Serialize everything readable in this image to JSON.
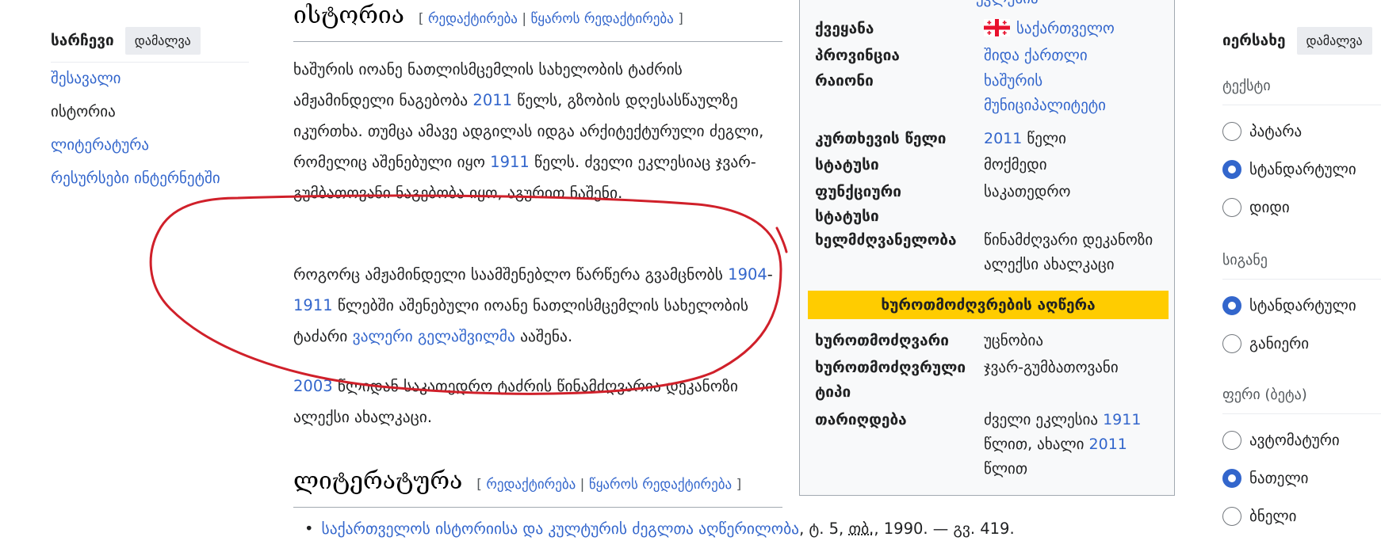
{
  "toc": {
    "title": "სარჩევი",
    "hide_label": "დამალვა",
    "items": [
      {
        "label": "შესავალი"
      },
      {
        "label": "ისტორია"
      },
      {
        "label": "ლიტერატურა"
      },
      {
        "label": "რესურსები ინტერნეტში"
      }
    ]
  },
  "history": {
    "title": "ისტორია",
    "edit_open": "[",
    "edit": "რედაქტირება",
    "pipe": "|",
    "edit_source": "წყაროს რედაქტირება",
    "edit_close": "]",
    "p1": {
      "a": "ხაშურის იოანე ნათლისმცემლის სახელობის ტაძრის ამჟამინდელი ნაგებობა ",
      "year1": "2011",
      "b": " წელს, გზობის დღესასწაულზე იკურთხა. თუმცა ამავე ადგილას იდგა არქიტექტურული ძეგლი, რომელიც აშენებული იყო ",
      "year2": "1911",
      "c": " წელს. ძველი ეკლესიაც ჯვარ-გუმბათოვანი ნაგებობა იყო, აგურით ნაშენი."
    },
    "p2": {
      "a": "როგორც ამჟამინდელი საამშენებლო წარწერა გვამცნობს ",
      "year1": "1904",
      "dash": "-",
      "year2": "1911",
      "b": " წლებში აშენებული იოანე ნათლისმცემლის სახელობის ტაძარი ",
      "link": "ვალერი გელაშვილმა",
      "c": " ააშენა."
    },
    "p3": {
      "year": "2003",
      "a": " წლიდან საკათედრო ტაძრის წინამძღვარია დეკანოზი ალექსი ახალკაცი."
    }
  },
  "literature": {
    "title": "ლიტერატურა",
    "edit_open": "[",
    "edit": "რედაქტირება",
    "pipe": "|",
    "edit_source": "წყაროს რედაქტირება",
    "edit_close": "]",
    "item": {
      "link": "საქართველოს ისტორიისა და კულტურის ძეგლთა აღწერილობა",
      "a": ", ტ. 5, ",
      "abbr": "თბ.",
      "b": ", 1990. — გვ. 419."
    }
  },
  "infobox": {
    "top_value": "ეკლესია",
    "rows": [
      {
        "label": "ქვეყანა",
        "value": "საქართველო"
      },
      {
        "label": "პროვინცია",
        "value": "შიდა ქართლი"
      },
      {
        "label": "რაიონი",
        "value": "ხაშურის მუნიციპალიტეტი"
      },
      {
        "label": "კურთხევის წელი",
        "value_year": "2011",
        "value_rest": " წელი"
      },
      {
        "label": "სტატუსი",
        "value": "მოქმედი"
      },
      {
        "label": "ფუნქციური სტატუსი",
        "value": "საკათედრო"
      },
      {
        "label": "ხელმძღვანელობა",
        "value": "წინამძღვარი დეკანოზი ალექსი ახალკაცი"
      }
    ],
    "header": "ხუროთმოძღვრების აღწერა",
    "rows2": [
      {
        "label": "ხუროთმოძღვარი",
        "value": "უცნობია"
      },
      {
        "label": "ხუროთმოძღვრული ტიპი",
        "value": "ჯვარ-გუმბათოვანი"
      },
      {
        "label": "თარიღდება",
        "v1": "ძველი ეკლესია ",
        "y1": "1911",
        "v2": " წლით, ახალი ",
        "y2": "2011",
        "v3": " წლით"
      }
    ]
  },
  "appearance": {
    "title": "იერსახე",
    "hide_label": "დამალვა",
    "text_label": "ტექსტი",
    "text_options": [
      {
        "label": "პატარა",
        "checked": false
      },
      {
        "label": "სტანდარტული",
        "checked": true
      },
      {
        "label": "დიდი",
        "checked": false
      }
    ],
    "width_label": "სიგანე",
    "width_options": [
      {
        "label": "სტანდარტული",
        "checked": true
      },
      {
        "label": "განიერი",
        "checked": false
      }
    ],
    "color_label": "ფერი (ბეტა)",
    "color_options": [
      {
        "label": "ავტომატური",
        "checked": false
      },
      {
        "label": "ნათელი",
        "checked": true
      },
      {
        "label": "ბნელი",
        "checked": false
      }
    ]
  },
  "colors": {
    "link": "#3366cc",
    "annotation": "#d0202a",
    "infobox_header": "#ffcc00"
  }
}
